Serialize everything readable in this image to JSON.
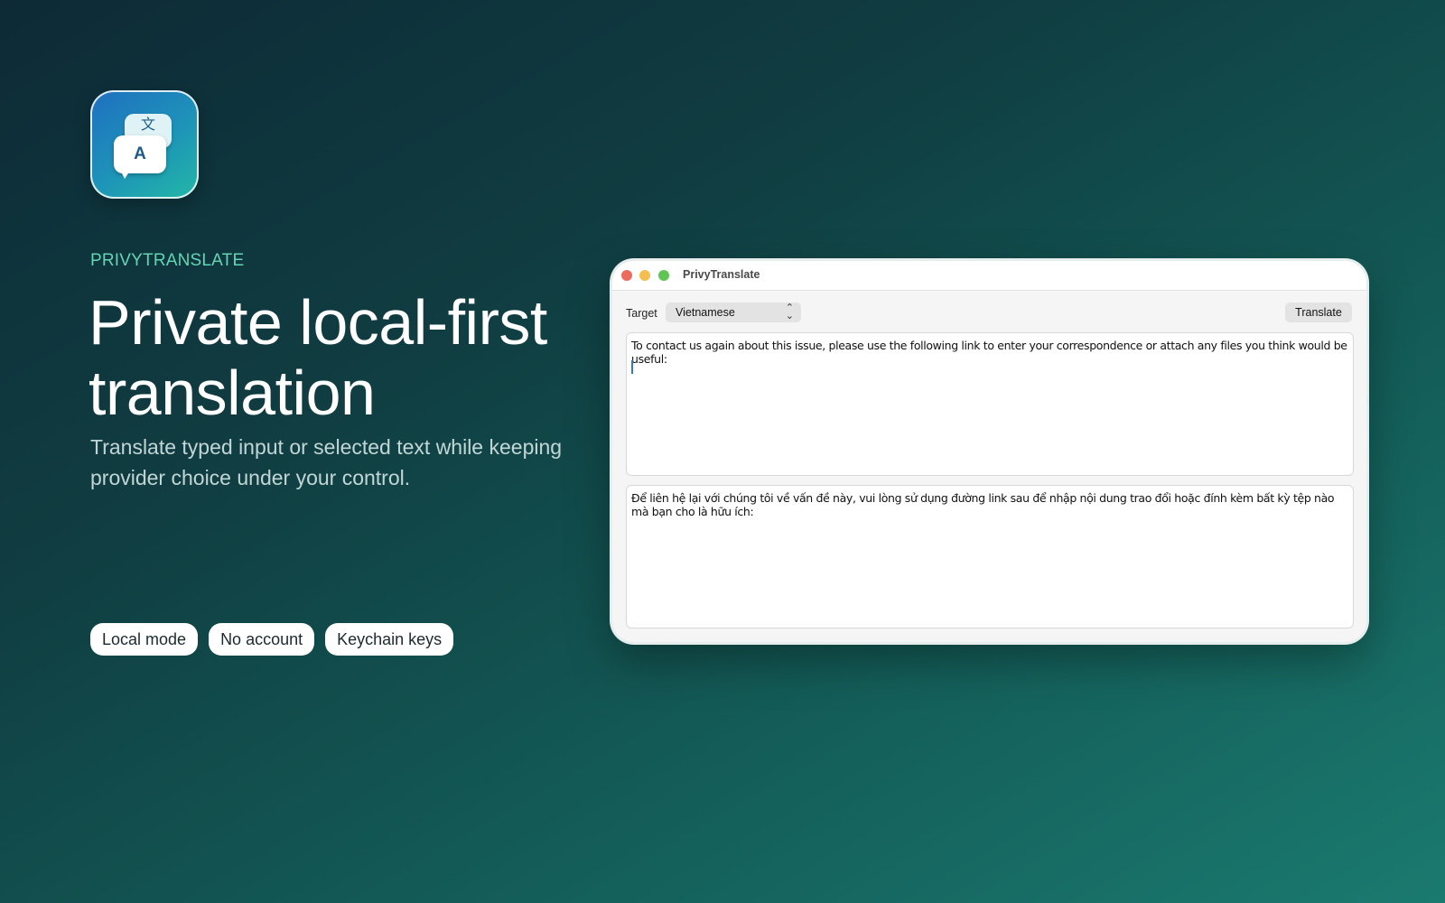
{
  "hero": {
    "eyebrow": "PRIVYTRANSLATE",
    "headline": "Private local-first translation",
    "subtitle": "Translate typed input or selected text while keeping provider choice under your control.",
    "icon": {
      "name": "translate-bubbles-icon",
      "back_glyph": "文",
      "front_glyph": "A",
      "gradient_start": "#1f6fc0",
      "gradient_end": "#22b8a6"
    },
    "chips": [
      "Local mode",
      "No account",
      "Keychain keys"
    ]
  },
  "window": {
    "title": "PrivyTranslate",
    "traffic_lights": {
      "close": "#ed6a5e",
      "minimize": "#f5bf4f",
      "maximize": "#61c554"
    },
    "target_label": "Target",
    "target_value": "Vietnamese",
    "translate_button": "Translate",
    "input_text": "To contact us again about this issue, please use the following link to enter your correspondence or attach any files you think would be useful:",
    "output_text": "Để liên hệ lại với chúng tôi về vấn đề này, vui lòng sử dụng đường link sau để nhập nội dung trao đổi hoặc đính kèm bất kỳ tệp nào mà bạn cho là hữu ích:"
  },
  "colors": {
    "background_start": "#0d2a36",
    "background_end": "#1a7a6f",
    "eyebrow": "#63d4b4",
    "headline": "#ffffff"
  }
}
